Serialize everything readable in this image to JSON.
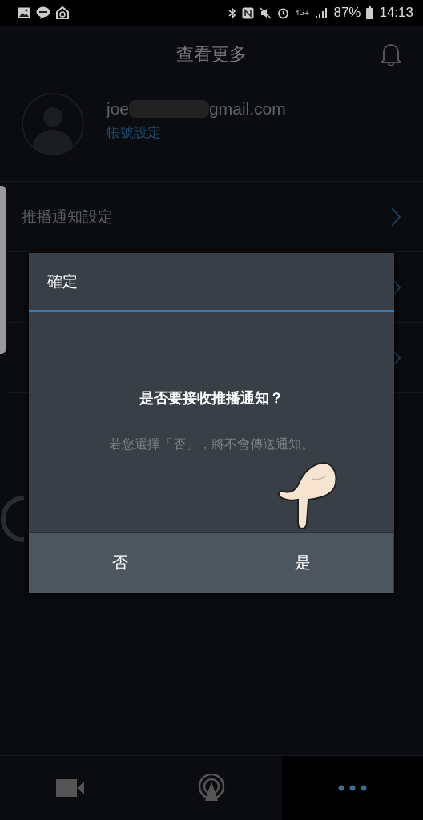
{
  "status_bar": {
    "network": "4G+",
    "battery": "87%",
    "time": "14:13"
  },
  "header": {
    "title": "查看更多"
  },
  "account": {
    "email_start": "joe",
    "email_end": "gmail.com",
    "link": "帳號設定"
  },
  "menu": [
    {
      "kind": "link",
      "label": "推播通知設定"
    },
    {
      "kind": "link"
    },
    {
      "kind": "link"
    }
  ],
  "dialog": {
    "title": "確定",
    "question": "是否要接收推播通知？",
    "note": "若您選擇「否」，將不會傳送通知。",
    "buttons": [
      "否",
      "是"
    ]
  },
  "bottom_nav": [
    {
      "kind": "camera",
      "selected": false
    },
    {
      "kind": "broadcast",
      "selected": false
    },
    {
      "kind": "more",
      "selected": true
    }
  ]
}
